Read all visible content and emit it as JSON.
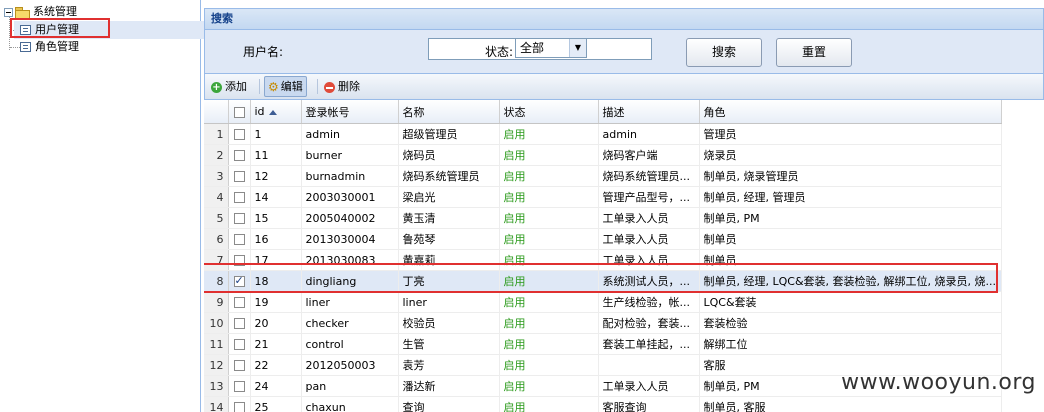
{
  "tree": {
    "root": "系统管理",
    "children": [
      "用户管理",
      "角色管理"
    ]
  },
  "search": {
    "title": "搜索",
    "username_label": "用户名:",
    "username_value": "",
    "status_label": "状态:",
    "status_value": "全部",
    "search_button": "搜索",
    "reset_button": "重置"
  },
  "toolbar": {
    "add": "添加",
    "edit": "编辑",
    "delete": "删除"
  },
  "grid": {
    "columns": [
      "id",
      "登录帐号",
      "名称",
      "状态",
      "描述",
      "角色"
    ],
    "rows": [
      {
        "n": "1",
        "id": "1",
        "account": "admin",
        "name": "超级管理员",
        "status": "启用",
        "desc": "admin",
        "role": "管理员",
        "checked": false
      },
      {
        "n": "2",
        "id": "11",
        "account": "burner",
        "name": "烧码员",
        "status": "启用",
        "desc": "烧码客户端",
        "role": "烧录员",
        "checked": false
      },
      {
        "n": "3",
        "id": "12",
        "account": "burnadmin",
        "name": "烧码系统管理员",
        "status": "启用",
        "desc": "烧码系统管理员...",
        "role": "制单员, 烧录管理员",
        "checked": false
      },
      {
        "n": "4",
        "id": "14",
        "account": "2003030001",
        "name": "梁启光",
        "status": "启用",
        "desc": "管理产品型号，...",
        "role": "制单员, 经理, 管理员",
        "checked": false
      },
      {
        "n": "5",
        "id": "15",
        "account": "2005040002",
        "name": "黄玉清",
        "status": "启用",
        "desc": "工单录入人员",
        "role": "制单员, PM",
        "checked": false
      },
      {
        "n": "6",
        "id": "16",
        "account": "2013030004",
        "name": "鲁苑琴",
        "status": "启用",
        "desc": "工单录入人员",
        "role": "制单员",
        "checked": false
      },
      {
        "n": "7",
        "id": "17",
        "account": "2013030083",
        "name": "黄嘉莉",
        "status": "启用",
        "desc": "工单录入人员",
        "role": "制单员",
        "checked": false
      },
      {
        "n": "8",
        "id": "18",
        "account": "dingliang",
        "name": "丁亮",
        "status": "启用",
        "desc": "系统测试人员，...",
        "role": "制单员, 经理, LQC&套装, 套装检验, 解绑工位, 烧录员, 烧...",
        "checked": true
      },
      {
        "n": "9",
        "id": "19",
        "account": "liner",
        "name": "liner",
        "status": "启用",
        "desc": "生产线检验，帐...",
        "role": "LQC&套装",
        "checked": false
      },
      {
        "n": "10",
        "id": "20",
        "account": "checker",
        "name": "校验员",
        "status": "启用",
        "desc": "配对检验，套装...",
        "role": "套装检验",
        "checked": false
      },
      {
        "n": "11",
        "id": "21",
        "account": "control",
        "name": "生管",
        "status": "启用",
        "desc": "套装工单挂起，...",
        "role": "解绑工位",
        "checked": false
      },
      {
        "n": "12",
        "id": "22",
        "account": "2012050003",
        "name": "袁芳",
        "status": "启用",
        "desc": "",
        "role": "客服",
        "checked": false
      },
      {
        "n": "13",
        "id": "24",
        "account": "pan",
        "name": "潘达新",
        "status": "启用",
        "desc": "工单录入人员",
        "role": "制单员, PM",
        "checked": false
      },
      {
        "n": "14",
        "id": "25",
        "account": "chaxun",
        "name": "查询",
        "status": "启用",
        "desc": "客服查询",
        "role": "制单员, 客服",
        "checked": false
      }
    ]
  },
  "watermark": "www.wooyun.org",
  "colors": {
    "header_blue": "#dfe8f6",
    "border_blue": "#99bbe8",
    "status_green": "#2a9a1a",
    "highlight_red": "#e03030"
  }
}
